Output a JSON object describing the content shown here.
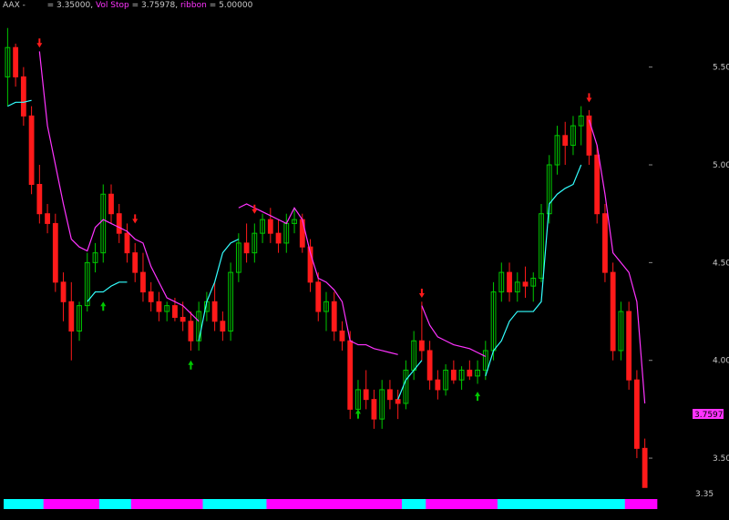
{
  "header": {
    "symbol": "AAX -",
    "price_text": "= 3.35000,",
    "volstop_label": "Vol Stop",
    "volstop_text": "= 3.75978,",
    "ribbon_label": "ribbon",
    "ribbon_text": "= 5.00000"
  },
  "colors": {
    "background": "#000000",
    "up_candle": "#00c800",
    "down_candle": "#ff1a1a",
    "volstop_upper": "#ff33ff",
    "volstop_lower": "#33ffff",
    "ribbon_cyan": "#00ffff",
    "ribbon_magenta": "#ff00ff",
    "axis_text": "#c8c8c8",
    "up_arrow": "#00c800",
    "down_arrow": "#ff1a1a"
  },
  "chart_data": {
    "type": "candlestick",
    "title": "",
    "ylim": [
      3.3,
      5.75
    ],
    "y_ticks": [
      "5.50",
      "5.00",
      "4.50",
      "4.00",
      "3.50"
    ],
    "last_price_label": "3.35",
    "volstop_value_label": "3.75978",
    "candles": [
      [
        5.45,
        5.7,
        5.3,
        5.6
      ],
      [
        5.6,
        5.62,
        5.4,
        5.45
      ],
      [
        5.45,
        5.5,
        5.2,
        5.25
      ],
      [
        5.25,
        5.3,
        4.85,
        4.9
      ],
      [
        4.9,
        5.0,
        4.7,
        4.75
      ],
      [
        4.75,
        4.8,
        4.65,
        4.7
      ],
      [
        4.7,
        4.75,
        4.35,
        4.4
      ],
      [
        4.4,
        4.45,
        4.2,
        4.3
      ],
      [
        4.3,
        4.4,
        4.0,
        4.15
      ],
      [
        4.15,
        4.3,
        4.1,
        4.28
      ],
      [
        4.28,
        4.55,
        4.25,
        4.5
      ],
      [
        4.5,
        4.6,
        4.45,
        4.55
      ],
      [
        4.55,
        4.9,
        4.5,
        4.85
      ],
      [
        4.85,
        4.9,
        4.7,
        4.75
      ],
      [
        4.75,
        4.8,
        4.6,
        4.65
      ],
      [
        4.65,
        4.7,
        4.5,
        4.55
      ],
      [
        4.55,
        4.6,
        4.4,
        4.45
      ],
      [
        4.45,
        4.55,
        4.3,
        4.35
      ],
      [
        4.35,
        4.4,
        4.25,
        4.3
      ],
      [
        4.3,
        4.35,
        4.2,
        4.25
      ],
      [
        4.25,
        4.3,
        4.2,
        4.28
      ],
      [
        4.28,
        4.32,
        4.2,
        4.22
      ],
      [
        4.22,
        4.3,
        4.15,
        4.2
      ],
      [
        4.2,
        4.25,
        4.05,
        4.1
      ],
      [
        4.1,
        4.3,
        4.05,
        4.25
      ],
      [
        4.25,
        4.35,
        4.2,
        4.3
      ],
      [
        4.3,
        4.4,
        4.15,
        4.2
      ],
      [
        4.2,
        4.25,
        4.1,
        4.15
      ],
      [
        4.15,
        4.5,
        4.1,
        4.45
      ],
      [
        4.45,
        4.65,
        4.4,
        4.6
      ],
      [
        4.6,
        4.7,
        4.5,
        4.55
      ],
      [
        4.55,
        4.7,
        4.5,
        4.65
      ],
      [
        4.65,
        4.75,
        4.6,
        4.72
      ],
      [
        4.72,
        4.78,
        4.6,
        4.65
      ],
      [
        4.65,
        4.72,
        4.55,
        4.6
      ],
      [
        4.6,
        4.75,
        4.55,
        4.7
      ],
      [
        4.7,
        4.78,
        4.65,
        4.72
      ],
      [
        4.72,
        4.75,
        4.55,
        4.58
      ],
      [
        4.58,
        4.62,
        4.35,
        4.4
      ],
      [
        4.4,
        4.45,
        4.2,
        4.25
      ],
      [
        4.25,
        4.35,
        4.15,
        4.3
      ],
      [
        4.3,
        4.35,
        4.1,
        4.15
      ],
      [
        4.15,
        4.2,
        4.05,
        4.1
      ],
      [
        4.1,
        4.15,
        3.7,
        3.75
      ],
      [
        3.75,
        3.9,
        3.7,
        3.85
      ],
      [
        3.85,
        3.95,
        3.75,
        3.8
      ],
      [
        3.8,
        3.85,
        3.65,
        3.7
      ],
      [
        3.7,
        3.9,
        3.65,
        3.85
      ],
      [
        3.85,
        3.9,
        3.75,
        3.8
      ],
      [
        3.8,
        3.85,
        3.7,
        3.78
      ],
      [
        3.78,
        4.0,
        3.75,
        3.95
      ],
      [
        3.95,
        4.15,
        3.9,
        4.1
      ],
      [
        4.1,
        4.3,
        4.0,
        4.05
      ],
      [
        4.05,
        4.1,
        3.85,
        3.9
      ],
      [
        3.9,
        3.95,
        3.8,
        3.85
      ],
      [
        3.85,
        3.98,
        3.82,
        3.95
      ],
      [
        3.95,
        4.0,
        3.88,
        3.9
      ],
      [
        3.9,
        3.97,
        3.85,
        3.95
      ],
      [
        3.95,
        4.0,
        3.9,
        3.92
      ],
      [
        3.92,
        4.0,
        3.88,
        3.95
      ],
      [
        3.95,
        4.1,
        3.9,
        4.05
      ],
      [
        4.05,
        4.4,
        4.0,
        4.35
      ],
      [
        4.35,
        4.5,
        4.3,
        4.45
      ],
      [
        4.45,
        4.5,
        4.3,
        4.35
      ],
      [
        4.35,
        4.45,
        4.3,
        4.4
      ],
      [
        4.4,
        4.48,
        4.32,
        4.38
      ],
      [
        4.38,
        4.45,
        4.3,
        4.42
      ],
      [
        4.42,
        4.8,
        4.4,
        4.75
      ],
      [
        4.75,
        5.05,
        4.7,
        5.0
      ],
      [
        5.0,
        5.2,
        4.95,
        5.15
      ],
      [
        5.15,
        5.22,
        5.0,
        5.1
      ],
      [
        5.1,
        5.25,
        5.05,
        5.2
      ],
      [
        5.2,
        5.3,
        5.1,
        5.25
      ],
      [
        5.25,
        5.28,
        5.0,
        5.05
      ],
      [
        5.05,
        5.1,
        4.7,
        4.75
      ],
      [
        4.75,
        4.8,
        4.4,
        4.45
      ],
      [
        4.45,
        4.5,
        4.0,
        4.05
      ],
      [
        4.05,
        4.3,
        4.0,
        4.25
      ],
      [
        4.25,
        4.3,
        3.85,
        3.9
      ],
      [
        3.9,
        3.95,
        3.5,
        3.55
      ],
      [
        3.55,
        3.6,
        3.35,
        3.35
      ]
    ],
    "volstop_upper": [
      [
        4,
        5.58
      ],
      [
        5,
        5.2
      ],
      [
        6,
        5.0
      ],
      [
        7,
        4.8
      ],
      [
        8,
        4.62
      ],
      [
        9,
        4.58
      ],
      [
        10,
        4.56
      ],
      [
        11,
        4.68
      ],
      [
        12,
        4.72
      ],
      [
        13,
        4.7
      ],
      [
        14,
        4.68
      ],
      [
        15,
        4.66
      ],
      [
        16,
        4.62
      ],
      [
        17,
        4.6
      ],
      [
        18,
        4.48
      ],
      [
        19,
        4.4
      ],
      [
        20,
        4.32
      ],
      [
        21,
        4.3
      ],
      [
        22,
        4.28
      ],
      [
        23,
        4.24
      ],
      [
        24,
        4.2
      ],
      [
        29,
        4.78
      ],
      [
        30,
        4.8
      ],
      [
        31,
        4.78
      ],
      [
        32,
        4.76
      ],
      [
        33,
        4.74
      ],
      [
        34,
        4.72
      ],
      [
        35,
        4.7
      ],
      [
        36,
        4.78
      ],
      [
        37,
        4.72
      ],
      [
        38,
        4.55
      ],
      [
        39,
        4.42
      ],
      [
        40,
        4.4
      ],
      [
        41,
        4.36
      ],
      [
        42,
        4.3
      ],
      [
        43,
        4.1
      ],
      [
        44,
        4.08
      ],
      [
        45,
        4.08
      ],
      [
        46,
        4.06
      ],
      [
        47,
        4.05
      ],
      [
        48,
        4.04
      ],
      [
        49,
        4.03
      ],
      [
        52,
        4.28
      ],
      [
        53,
        4.18
      ],
      [
        54,
        4.12
      ],
      [
        55,
        4.1
      ],
      [
        56,
        4.08
      ],
      [
        57,
        4.07
      ],
      [
        58,
        4.06
      ],
      [
        59,
        4.04
      ],
      [
        60,
        4.02
      ],
      [
        73,
        5.23
      ],
      [
        74,
        5.1
      ],
      [
        75,
        4.85
      ],
      [
        76,
        4.55
      ],
      [
        77,
        4.5
      ],
      [
        78,
        4.45
      ],
      [
        79,
        4.3
      ],
      [
        80,
        3.78
      ]
    ],
    "volstop_lower": [
      [
        0,
        5.3
      ],
      [
        1,
        5.32
      ],
      [
        2,
        5.32
      ],
      [
        3,
        5.33
      ],
      [
        10,
        4.3
      ],
      [
        11,
        4.35
      ],
      [
        12,
        4.35
      ],
      [
        13,
        4.38
      ],
      [
        14,
        4.4
      ],
      [
        15,
        4.4
      ],
      [
        24,
        4.1
      ],
      [
        25,
        4.3
      ],
      [
        26,
        4.4
      ],
      [
        27,
        4.55
      ],
      [
        28,
        4.6
      ],
      [
        29,
        4.62
      ],
      [
        49,
        3.8
      ],
      [
        50,
        3.9
      ],
      [
        51,
        3.95
      ],
      [
        52,
        4.0
      ],
      [
        60,
        3.92
      ],
      [
        61,
        4.05
      ],
      [
        62,
        4.1
      ],
      [
        63,
        4.2
      ],
      [
        64,
        4.25
      ],
      [
        65,
        4.25
      ],
      [
        66,
        4.25
      ],
      [
        67,
        4.3
      ],
      [
        68,
        4.8
      ],
      [
        69,
        4.85
      ],
      [
        70,
        4.88
      ],
      [
        71,
        4.9
      ],
      [
        72,
        5.0
      ]
    ],
    "arrows": [
      {
        "dir": "down",
        "i": 4,
        "price": 5.6
      },
      {
        "dir": "up",
        "i": 12,
        "price": 4.3
      },
      {
        "dir": "down",
        "i": 16,
        "price": 4.7
      },
      {
        "dir": "up",
        "i": 23,
        "price": 4.0
      },
      {
        "dir": "down",
        "i": 31,
        "price": 4.75
      },
      {
        "dir": "up",
        "i": 44,
        "price": 3.75
      },
      {
        "dir": "down",
        "i": 52,
        "price": 4.32
      },
      {
        "dir": "up",
        "i": 59,
        "price": 3.84
      },
      {
        "dir": "down",
        "i": 73,
        "price": 5.32
      }
    ],
    "ribbon": [
      "cyan",
      "cyan",
      "cyan",
      "cyan",
      "cyan",
      "magenta",
      "magenta",
      "magenta",
      "magenta",
      "magenta",
      "magenta",
      "magenta",
      "cyan",
      "cyan",
      "cyan",
      "cyan",
      "magenta",
      "magenta",
      "magenta",
      "magenta",
      "magenta",
      "magenta",
      "magenta",
      "magenta",
      "magenta",
      "cyan",
      "cyan",
      "cyan",
      "cyan",
      "cyan",
      "cyan",
      "cyan",
      "cyan",
      "magenta",
      "magenta",
      "magenta",
      "magenta",
      "magenta",
      "magenta",
      "magenta",
      "magenta",
      "magenta",
      "magenta",
      "magenta",
      "magenta",
      "magenta",
      "magenta",
      "magenta",
      "magenta",
      "magenta",
      "cyan",
      "cyan",
      "cyan",
      "magenta",
      "magenta",
      "magenta",
      "magenta",
      "magenta",
      "magenta",
      "magenta",
      "magenta",
      "magenta",
      "cyan",
      "cyan",
      "cyan",
      "cyan",
      "cyan",
      "cyan",
      "cyan",
      "cyan",
      "cyan",
      "cyan",
      "cyan",
      "cyan",
      "cyan",
      "cyan",
      "cyan",
      "cyan",
      "magenta",
      "magenta",
      "magenta",
      "magenta"
    ]
  }
}
